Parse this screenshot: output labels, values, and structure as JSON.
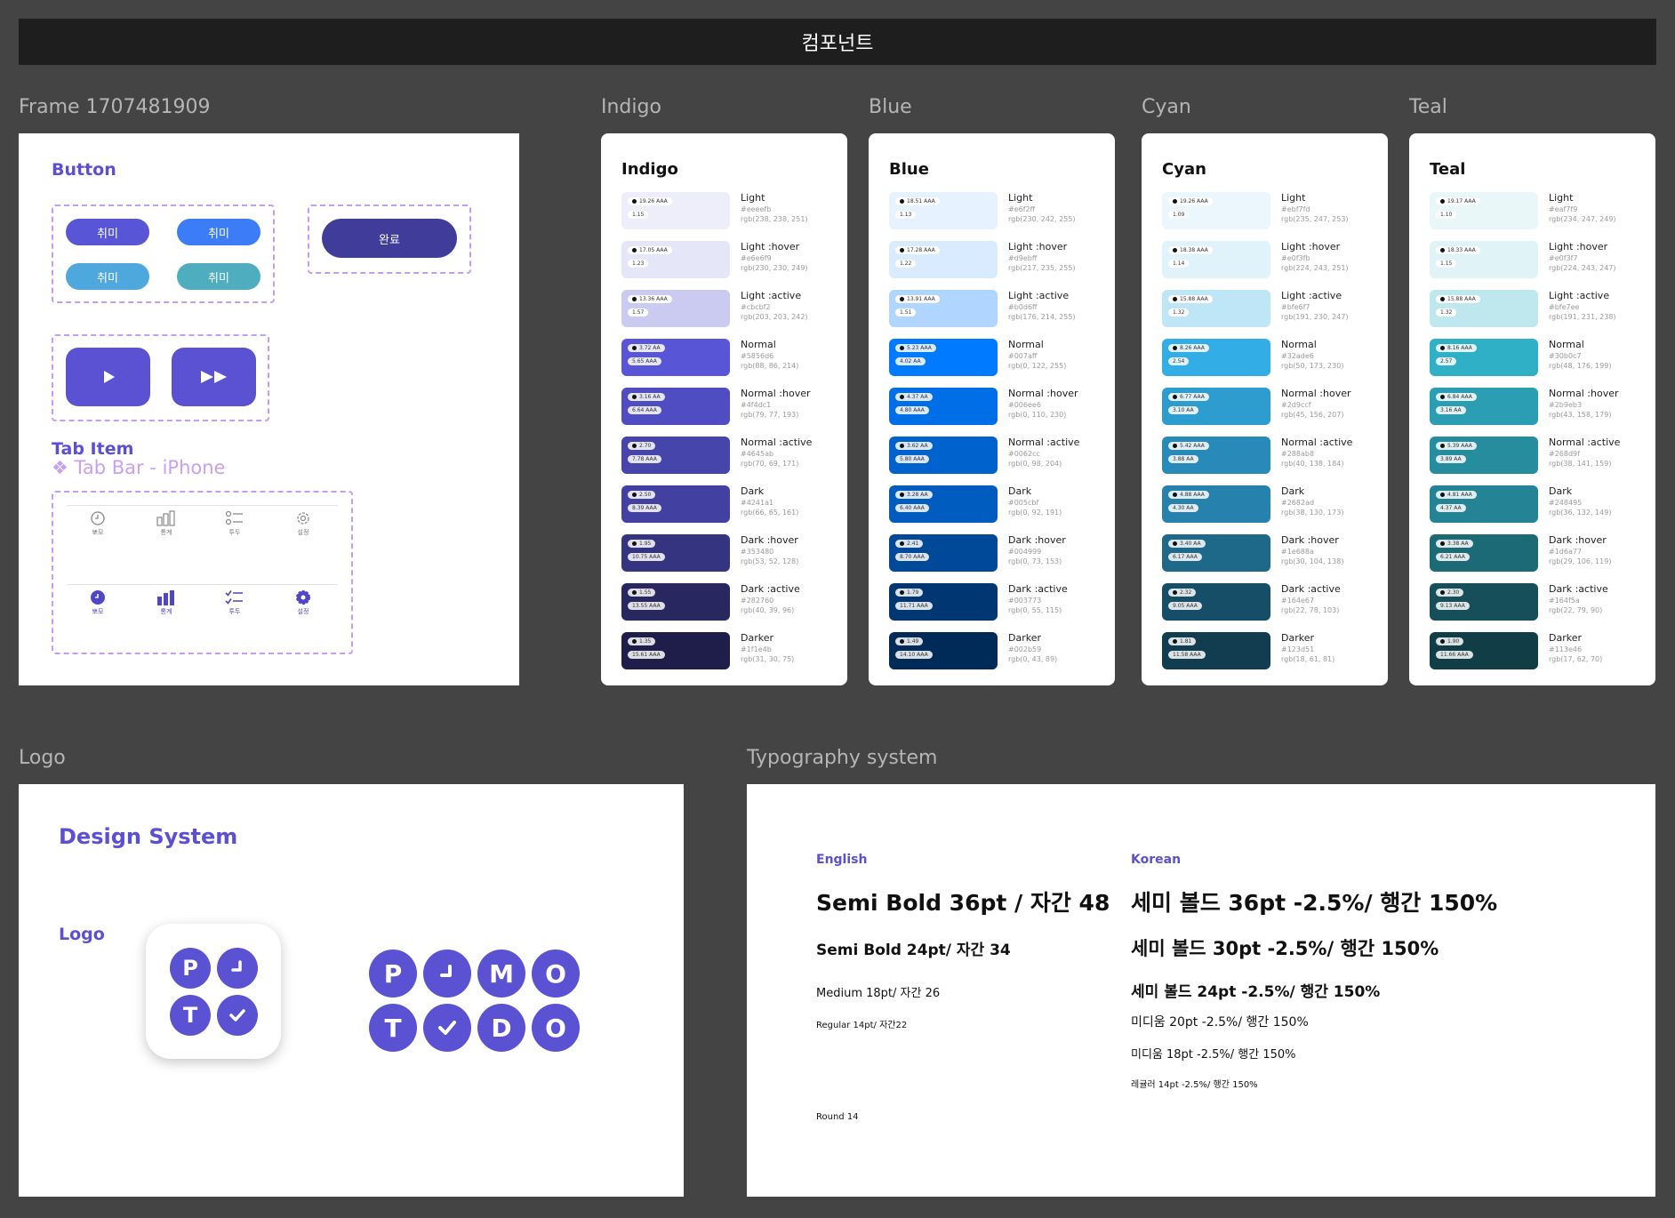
{
  "header": {
    "title": "컴포넌트"
  },
  "frame": {
    "label": "Frame 1707481909",
    "button_section": "Button",
    "small_buttons": [
      {
        "label": "취미",
        "color": "#5856d6"
      },
      {
        "label": "취미",
        "color": "#3c7cf6"
      },
      {
        "label": "취미",
        "color": "#4ea8dd"
      },
      {
        "label": "취미",
        "color": "#4fadc0"
      }
    ],
    "done_button": {
      "label": "완료",
      "color": "#3f3c9a"
    },
    "tab_item_title": "Tab Item",
    "tab_bar_label": "❖ Tab Bar - iPhone",
    "tabs": [
      {
        "label": "뽀모",
        "icon": "clock-icon"
      },
      {
        "label": "통계",
        "icon": "bar-chart-icon"
      },
      {
        "label": "투두",
        "icon": "checklist-icon"
      },
      {
        "label": "설정",
        "icon": "gear-icon"
      }
    ]
  },
  "palettes": [
    {
      "label": "Indigo",
      "title": "Indigo",
      "swatches": [
        {
          "name": "Light",
          "hex": "#eeeefb",
          "rgb": "rgb(238, 238, 251)",
          "ratio": "19.26 AAA",
          "sub": "1.15"
        },
        {
          "name": "Light :hover",
          "hex": "#e6e6f9",
          "rgb": "rgb(230, 230, 249)",
          "ratio": "17.05 AAA",
          "sub": "1.23"
        },
        {
          "name": "Light :active",
          "hex": "#cbcbf2",
          "rgb": "rgb(203, 203, 242)",
          "ratio": "13.36 AAA",
          "sub": "1.57"
        },
        {
          "name": "Normal",
          "hex": "#5856d6",
          "rgb": "rgb(88, 86, 214)",
          "ratio": "3.72 AA",
          "sub": "5.65 AAA"
        },
        {
          "name": "Normal :hover",
          "hex": "#4f4dc1",
          "rgb": "rgb(79, 77, 193)",
          "ratio": "3.16 AA",
          "sub": "6.64 AAA"
        },
        {
          "name": "Normal :active",
          "hex": "#4645ab",
          "rgb": "rgb(70, 69, 171)",
          "ratio": "2.70",
          "sub": "7.78 AAA"
        },
        {
          "name": "Dark",
          "hex": "#4241a1",
          "rgb": "rgb(66, 65, 161)",
          "ratio": "2.50",
          "sub": "8.39 AAA"
        },
        {
          "name": "Dark :hover",
          "hex": "#353480",
          "rgb": "rgb(53, 52, 128)",
          "ratio": "1.95",
          "sub": "10.75 AAA"
        },
        {
          "name": "Dark :active",
          "hex": "#282760",
          "rgb": "rgb(40, 39, 96)",
          "ratio": "1.55",
          "sub": "13.55 AAA"
        },
        {
          "name": "Darker",
          "hex": "#1f1e4b",
          "rgb": "rgb(31, 30, 75)",
          "ratio": "1.35",
          "sub": "15.61 AAA"
        }
      ]
    },
    {
      "label": "Blue",
      "title": "Blue",
      "swatches": [
        {
          "name": "Light",
          "hex": "#e6f2ff",
          "rgb": "rgb(230, 242, 255)",
          "ratio": "18.51 AAA",
          "sub": "1.13"
        },
        {
          "name": "Light :hover",
          "hex": "#d9ebff",
          "rgb": "rgb(217, 235, 255)",
          "ratio": "17.28 AAA",
          "sub": "1.22"
        },
        {
          "name": "Light :active",
          "hex": "#b0d6ff",
          "rgb": "rgb(176, 214, 255)",
          "ratio": "13.91 AAA",
          "sub": "1.51"
        },
        {
          "name": "Normal",
          "hex": "#007aff",
          "rgb": "rgb(0, 122, 255)",
          "ratio": "5.23 AAA",
          "sub": "4.02 AA"
        },
        {
          "name": "Normal :hover",
          "hex": "#006ee6",
          "rgb": "rgb(0, 110, 230)",
          "ratio": "4.37 AA",
          "sub": "4.80 AAA"
        },
        {
          "name": "Normal :active",
          "hex": "#0062cc",
          "rgb": "rgb(0, 98, 204)",
          "ratio": "3.62 AA",
          "sub": "5.80 AAA"
        },
        {
          "name": "Dark",
          "hex": "#005cbf",
          "rgb": "rgb(0, 92, 191)",
          "ratio": "3.28 AA",
          "sub": "6.40 AAA"
        },
        {
          "name": "Dark :hover",
          "hex": "#004999",
          "rgb": "rgb(0, 73, 153)",
          "ratio": "2.41",
          "sub": "8.70 AAA"
        },
        {
          "name": "Dark :active",
          "hex": "#003773",
          "rgb": "rgb(0, 55, 115)",
          "ratio": "1.79",
          "sub": "11.71 AAA"
        },
        {
          "name": "Darker",
          "hex": "#002b59",
          "rgb": "rgb(0, 43, 89)",
          "ratio": "1.49",
          "sub": "14.10 AAA"
        }
      ]
    },
    {
      "label": "Cyan",
      "title": "Cyan",
      "swatches": [
        {
          "name": "Light",
          "hex": "#ebf7fd",
          "rgb": "rgb(235, 247, 253)",
          "ratio": "19.26 AAA",
          "sub": "1.09"
        },
        {
          "name": "Light :hover",
          "hex": "#e0f3fb",
          "rgb": "rgb(224, 243, 251)",
          "ratio": "18.38 AAA",
          "sub": "1.14"
        },
        {
          "name": "Light :active",
          "hex": "#bfe6f7",
          "rgb": "rgb(191, 230, 247)",
          "ratio": "15.88 AAA",
          "sub": "1.32"
        },
        {
          "name": "Normal",
          "hex": "#32ade6",
          "rgb": "rgb(50, 173, 230)",
          "ratio": "8.26 AAA",
          "sub": "2.54"
        },
        {
          "name": "Normal :hover",
          "hex": "#2d9ccf",
          "rgb": "rgb(45, 156, 207)",
          "ratio": "6.77 AAA",
          "sub": "3.10 AA"
        },
        {
          "name": "Normal :active",
          "hex": "#288ab8",
          "rgb": "rgb(40, 138, 184)",
          "ratio": "5.42 AAA",
          "sub": "3.88 AA"
        },
        {
          "name": "Dark",
          "hex": "#2682ad",
          "rgb": "rgb(38, 130, 173)",
          "ratio": "4.88 AAA",
          "sub": "4.30 AA"
        },
        {
          "name": "Dark :hover",
          "hex": "#1e688a",
          "rgb": "rgb(30, 104, 138)",
          "ratio": "3.40 AA",
          "sub": "6.17 AAA"
        },
        {
          "name": "Dark :active",
          "hex": "#164e67",
          "rgb": "rgb(22, 78, 103)",
          "ratio": "2.32",
          "sub": "9.05 AAA"
        },
        {
          "name": "Darker",
          "hex": "#123d51",
          "rgb": "rgb(18, 61, 81)",
          "ratio": "1.81",
          "sub": "11.58 AAA"
        }
      ]
    },
    {
      "label": "Teal",
      "title": "Teal",
      "swatches": [
        {
          "name": "Light",
          "hex": "#eaf7f9",
          "rgb": "rgb(234, 247, 249)",
          "ratio": "19.17 AAA",
          "sub": "1.10"
        },
        {
          "name": "Light :hover",
          "hex": "#e0f3f7",
          "rgb": "rgb(224, 243, 247)",
          "ratio": "18.33 AAA",
          "sub": "1.15"
        },
        {
          "name": "Light :active",
          "hex": "#bfe7ee",
          "rgb": "rgb(191, 231, 238)",
          "ratio": "15.88 AAA",
          "sub": "1.32"
        },
        {
          "name": "Normal",
          "hex": "#30b0c7",
          "rgb": "rgb(48, 176, 199)",
          "ratio": "8.16 AAA",
          "sub": "2.57"
        },
        {
          "name": "Normal :hover",
          "hex": "#2b9eb3",
          "rgb": "rgb(43, 158, 179)",
          "ratio": "6.84 AAA",
          "sub": "3.16 AA"
        },
        {
          "name": "Normal :active",
          "hex": "#268d9f",
          "rgb": "rgb(38, 141, 159)",
          "ratio": "5.39 AAA",
          "sub": "3.89 AA"
        },
        {
          "name": "Dark",
          "hex": "#248495",
          "rgb": "rgb(36, 132, 149)",
          "ratio": "4.81 AAA",
          "sub": "4.37 AA"
        },
        {
          "name": "Dark :hover",
          "hex": "#1d6a77",
          "rgb": "rgb(29, 106, 119)",
          "ratio": "3.38 AA",
          "sub": "6.21 AAA"
        },
        {
          "name": "Dark :active",
          "hex": "#164f5a",
          "rgb": "rgb(22, 79, 90)",
          "ratio": "2.30",
          "sub": "9.13 AAA"
        },
        {
          "name": "Darker",
          "hex": "#113e46",
          "rgb": "rgb(17, 62, 70)",
          "ratio": "1.90",
          "sub": "11.66 AAA"
        }
      ]
    }
  ],
  "logo": {
    "label": "Logo",
    "design_system": "Design System",
    "logo_title": "Logo",
    "app_icon_letters": [
      "P",
      "",
      "T",
      ""
    ],
    "wordmark_letters": [
      "P",
      "",
      "M",
      "O",
      "T",
      "",
      "D",
      "O"
    ],
    "accent_color": "#5a52d2"
  },
  "typography": {
    "label": "Typography system",
    "english_title": "English",
    "korean_title": "Korean",
    "english": [
      "Semi Bold 36pt / 자간 48",
      "Semi Bold 24pt/ 자간 34",
      "Medium 18pt/ 자간 26",
      "Regular 14pt/ 자간22",
      "Round 14"
    ],
    "korean": [
      "세미 볼드 36pt -2.5%/ 행간 150%",
      "세미 볼드 30pt -2.5%/ 행간 150%",
      "세미 볼드 24pt -2.5%/ 행간 150%",
      "미디움 20pt -2.5%/ 행간 150%",
      "미디움 18pt -2.5%/ 행간 150%",
      "레귤러 14pt -2.5%/ 행간 150%"
    ]
  }
}
